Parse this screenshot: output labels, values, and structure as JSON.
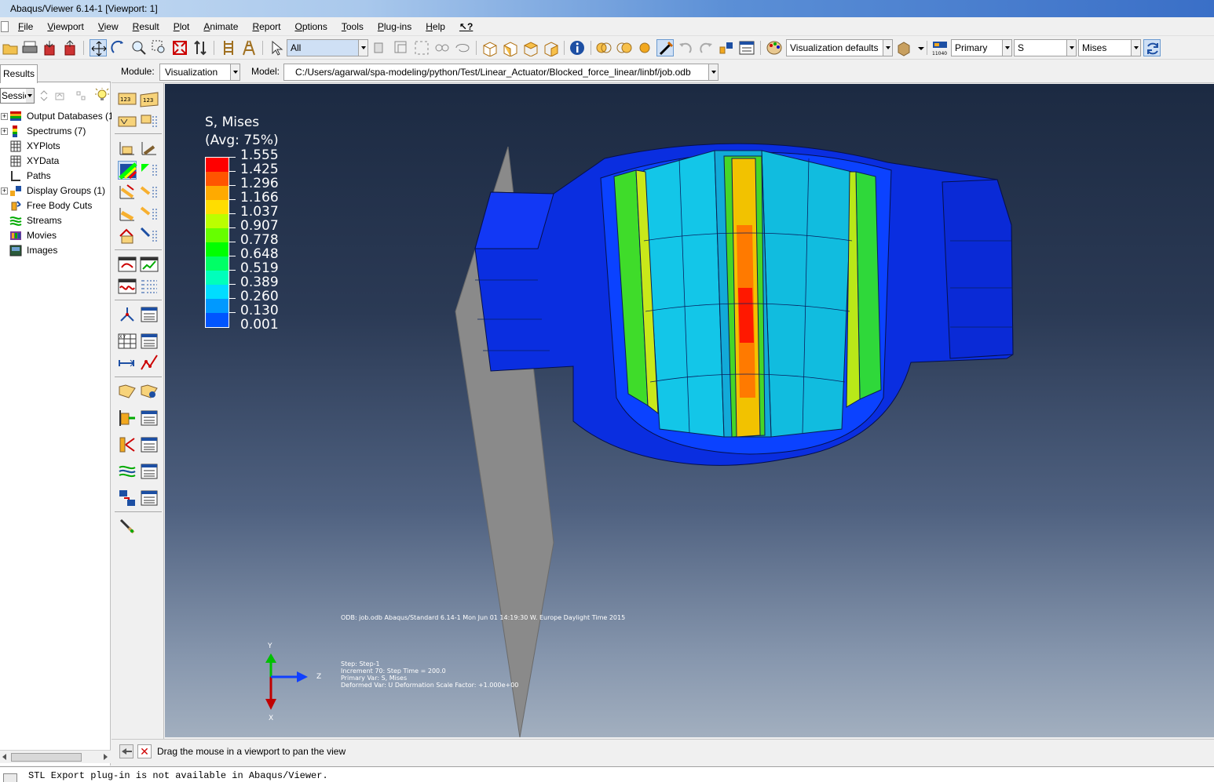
{
  "window": {
    "title": "Abaqus/Viewer 6.14-1 [Viewport: 1]"
  },
  "menu": {
    "items": [
      "File",
      "Viewport",
      "View",
      "Result",
      "Plot",
      "Animate",
      "Report",
      "Options",
      "Tools",
      "Plug-ins",
      "Help"
    ]
  },
  "toolbar": {
    "selection_filter": "All",
    "render_style": "Visualization defaults",
    "variable_position": "Primary",
    "variable": "S",
    "component": "Mises"
  },
  "context": {
    "module_label": "Module:",
    "module_value": "Visualization",
    "model_label": "Model:",
    "model_value": "C:/Users/agarwal/spa-modeling/python/Test/Linear_Actuator/Blocked_force_linear/linbf/job.odb"
  },
  "results_panel": {
    "tab_label": "Results",
    "session_label": "Sessio",
    "tree": [
      {
        "label": "Output Databases (1",
        "expandable": true,
        "icon": "database-icon"
      },
      {
        "label": "Spectrums (7)",
        "expandable": true,
        "icon": "spectrum-icon"
      },
      {
        "label": "XYPlots",
        "expandable": false,
        "icon": "grid-icon"
      },
      {
        "label": "XYData",
        "expandable": false,
        "icon": "grid-icon"
      },
      {
        "label": "Paths",
        "expandable": false,
        "icon": "path-icon"
      },
      {
        "label": "Display Groups (1)",
        "expandable": true,
        "icon": "display-group-icon"
      },
      {
        "label": "Free Body Cuts",
        "expandable": false,
        "icon": "free-body-icon"
      },
      {
        "label": "Streams",
        "expandable": false,
        "icon": "stream-icon"
      },
      {
        "label": "Movies",
        "expandable": false,
        "icon": "movie-icon"
      },
      {
        "label": "Images",
        "expandable": false,
        "icon": "image-icon"
      }
    ]
  },
  "legend": {
    "title_line1": "S, Mises",
    "title_line2": "(Avg: 75%)",
    "values": [
      "1.555",
      "1.425",
      "1.296",
      "1.166",
      "1.037",
      "0.907",
      "0.778",
      "0.648",
      "0.519",
      "0.389",
      "0.260",
      "0.130",
      "0.001"
    ],
    "colors": [
      "#ff0000",
      "#ff5500",
      "#ffaa00",
      "#ffdd00",
      "#bbff00",
      "#66ff00",
      "#00ff00",
      "#00ff66",
      "#00ffbb",
      "#00ddff",
      "#0099ff",
      "#0055ff",
      "#0000ff"
    ]
  },
  "viewport_info": {
    "odb_line": "ODB: job.odb    Abaqus/Standard 6.14-1    Mon Jun 01 14:19:30 W. Europe Daylight Time 2015",
    "step_line": "Step: Step-1",
    "increment_line": "Increment    70: Step Time =    200.0",
    "primary_var_line": "Primary Var: S, Mises",
    "deformed_var_line": "Deformed Var: U   Deformation Scale Factor: +1.000e+00",
    "triad_y": "Y",
    "triad_z": "Z",
    "triad_x": "X"
  },
  "prompt": {
    "text": "Drag the mouse in a viewport to pan the view"
  },
  "message": {
    "text": "STL Export plug-in is not available in Abaqus/Viewer."
  }
}
